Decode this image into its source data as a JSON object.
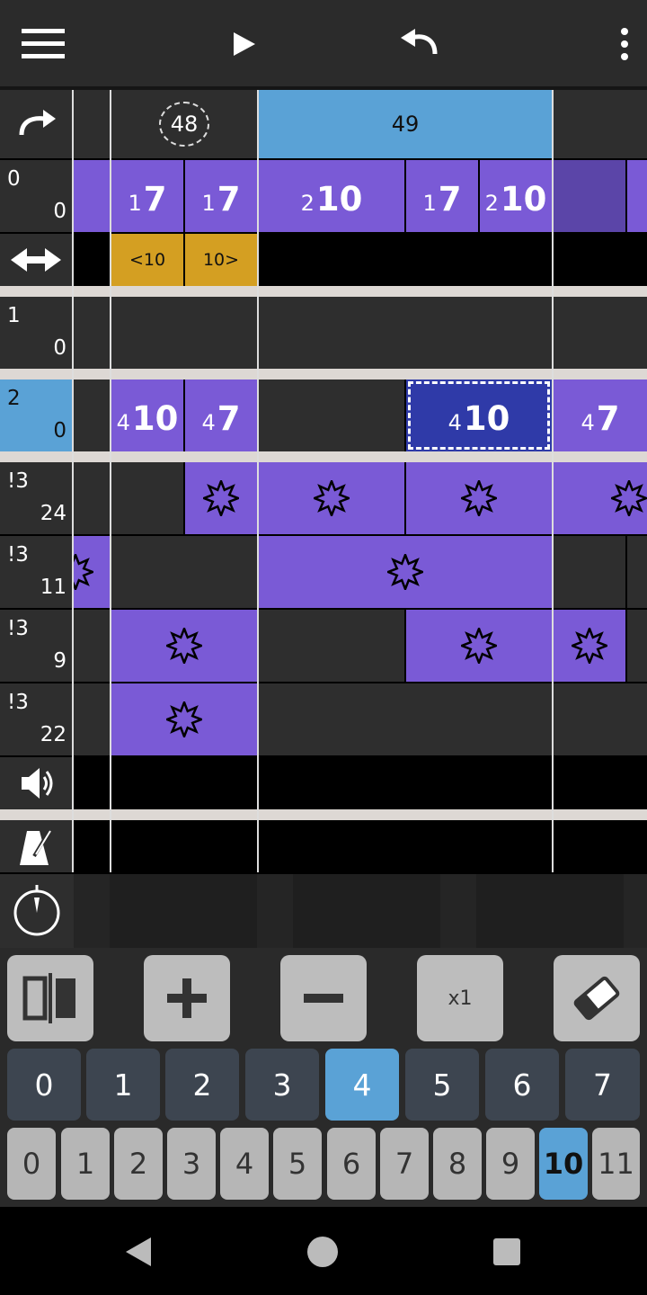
{
  "toolbar": {
    "icons": [
      "menu-icon",
      "play-icon",
      "undo-icon",
      "more-vert-icon"
    ]
  },
  "measures": {
    "redo_icon": "redo-icon",
    "m48": "48",
    "m49": "49"
  },
  "row_tempo": {
    "icon": "swap-horizontal-icon",
    "left": "<10",
    "right": "10>"
  },
  "rows": [
    {
      "tl": "0",
      "br": "0"
    },
    {
      "tl": "1",
      "br": "0"
    },
    {
      "tl": "2",
      "br": "0"
    },
    {
      "tl": "!3",
      "br": "24"
    },
    {
      "tl": "!3",
      "br": "11"
    },
    {
      "tl": "!3",
      "br": "9"
    },
    {
      "tl": "!3",
      "br": "22"
    }
  ],
  "row0_notes": [
    {
      "sub": "1",
      "big": "7"
    },
    {
      "sub": "1",
      "big": "7"
    },
    {
      "sub": "2",
      "big": "10"
    },
    {
      "sub": "1",
      "big": "7"
    },
    {
      "sub": "2",
      "big": "10"
    }
  ],
  "row2_notes": [
    {
      "sub": "4",
      "big": "10"
    },
    {
      "sub": "4",
      "big": "7"
    },
    {
      "sub": "4",
      "big": "10"
    },
    {
      "sub": "4",
      "big": "7"
    }
  ],
  "bottom_rows_icons": [
    "volume-icon",
    "metronome-icon",
    "timer-icon"
  ],
  "tools": {
    "split_icon": "split-icon",
    "add_icon": "plus-icon",
    "remove_icon": "minus-icon",
    "multiplier": "x1",
    "erase_icon": "eraser-icon"
  },
  "octaves": [
    "0",
    "1",
    "2",
    "3",
    "4",
    "5",
    "6",
    "7"
  ],
  "octave_selected": "4",
  "pitches": [
    "0",
    "1",
    "2",
    "3",
    "4",
    "5",
    "6",
    "7",
    "8",
    "9",
    "10",
    "11"
  ],
  "pitch_selected": "10",
  "nav": [
    "back-icon",
    "home-icon",
    "recents-icon"
  ],
  "colors": {
    "purple": "#7a5ad6",
    "blue": "#5aa2d6",
    "gold": "#d49f22",
    "selected": "#2f3aa8"
  }
}
